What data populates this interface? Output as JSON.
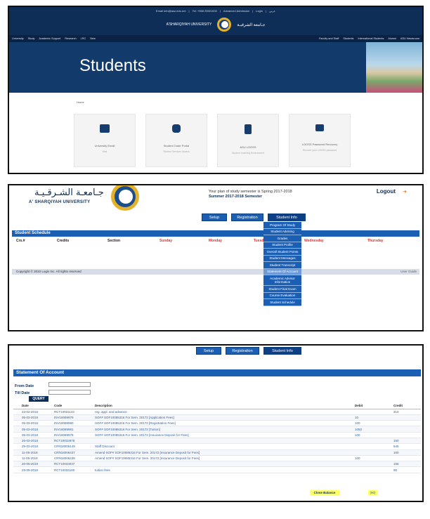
{
  "colors": {
    "navy": "#0f2e57",
    "blue": "#1a5fb4",
    "gold": "#e4b12b",
    "highlight": "#ffff66"
  },
  "panel1": {
    "top_links": [
      "Email info@asu.edu.om",
      "Tel: +968 25501000",
      "Advanced Admission",
      "Login",
      "عربي"
    ],
    "brand_en": "A'SHARQIYAH UNIVERSITY",
    "brand_ar": "جـامعة الشرقيـة",
    "nav_left": [
      "University",
      "Study",
      "Academic Support",
      "Research",
      "LRC",
      "New"
    ],
    "nav_right": [
      "Faculty and Staff",
      "Students",
      "International Students",
      "Alumni",
      "ASU Newsroom"
    ],
    "hero_title": "Students",
    "breadcrumb": "Home",
    "cards": [
      {
        "title": "University Email",
        "sub": "Mail",
        "icon": "email-icon"
      },
      {
        "title": "Student Outer Portal",
        "sub": "Student Services Access",
        "icon": "portal-icon"
      },
      {
        "title": "ASU LOOSS",
        "sub": "Student Learning Environment",
        "icon": "learning-icon"
      },
      {
        "title": "LOOSS Password Recovery",
        "sub": "Recover your LOOSS password",
        "icon": "password-icon"
      }
    ]
  },
  "panel2": {
    "logo_ar": "جـامعـة الشـرقـيـة",
    "logo_en": "A' SHARQIYAH UNIVERSITY",
    "info_line1": "Your plan of study semester is Spring 2017-2018",
    "info_line2": "Summer 2017-2018 Semester",
    "logout": "Logout",
    "menu": [
      "Setup",
      "Registration",
      "Student Info"
    ],
    "section_title": "Student Schedule",
    "columns": [
      "Crs.#",
      "Credits",
      "Section",
      "Sunday",
      "Monday",
      "Tuesday",
      "Wednesday",
      "Thursday"
    ],
    "footer": "Copyright © 2010 Logix Inc. All rights reserved",
    "footer_right": "User Guide",
    "dropdown": [
      "Program Of Study",
      "Student Advising",
      "Grades",
      "Student Profile",
      "Overall Student Points",
      "Student Messages",
      "Student Transcript",
      "Statement Of Account",
      "Academic Advisor Information",
      "Student Final Exam",
      "Course Evaluation",
      "Student Schedule"
    ],
    "dropdown_highlight": "Statement Of Account"
  },
  "panel3": {
    "menu": [
      "Setup",
      "Registration",
      "Student Info"
    ],
    "section_title": "Statement Of Account",
    "from_label": "From Date",
    "till_label": "Till Date",
    "query_label": "QUERY",
    "headers": [
      "Date",
      "Code",
      "Description",
      "Debit",
      "Credit"
    ],
    "rows": [
      [
        "22-02-2018",
        "RCT10031123",
        "reg. appl. and advance",
        "",
        "310"
      ],
      [
        "05-03-2018",
        "INV18089979",
        "SOF# SOF10085316 For Sem. 20172 [Application Fees]",
        "10",
        ""
      ],
      [
        "05-03-2018",
        "INV18089980",
        "SOF# SOF10085316 For Sem. 20172 [Registration Fees]",
        "100",
        ""
      ],
      [
        "05-03-2018",
        "INV18089981",
        "SOF# SOF10085316 For Sem. 20172 [Tuition]",
        "1050",
        ""
      ],
      [
        "05-03-2018",
        "INV18089978",
        "SOF# SOF10085316 For Sem. 20172 [Insurance Deposit for Fees]",
        "100",
        ""
      ],
      [
        "26-03-2018",
        "RCT10032878",
        "",
        "",
        "150"
      ],
      [
        "29-03-2018",
        "CRN18006149",
        "Staff Discount",
        "",
        "645"
      ],
      [
        "11-05-2018",
        "CRN18006437",
        "Amend SOF# SOF10085316 For Sem. 20172 [Insurance Deposit for Fees]",
        "",
        "100"
      ],
      [
        "11-05-2018",
        "CRN18006438",
        "Amend SOF# SOF10085316 For Sem. 20172 [Insurance Deposit for Fees]",
        "100",
        ""
      ],
      [
        "20-05-2018",
        "RCT10033037",
        "",
        "",
        "155"
      ],
      [
        "25-05-2018",
        "RCT10033180",
        "tuition fees",
        "",
        "90"
      ]
    ],
    "balance_label": "Close Balance",
    "balance_value": "(90)"
  }
}
